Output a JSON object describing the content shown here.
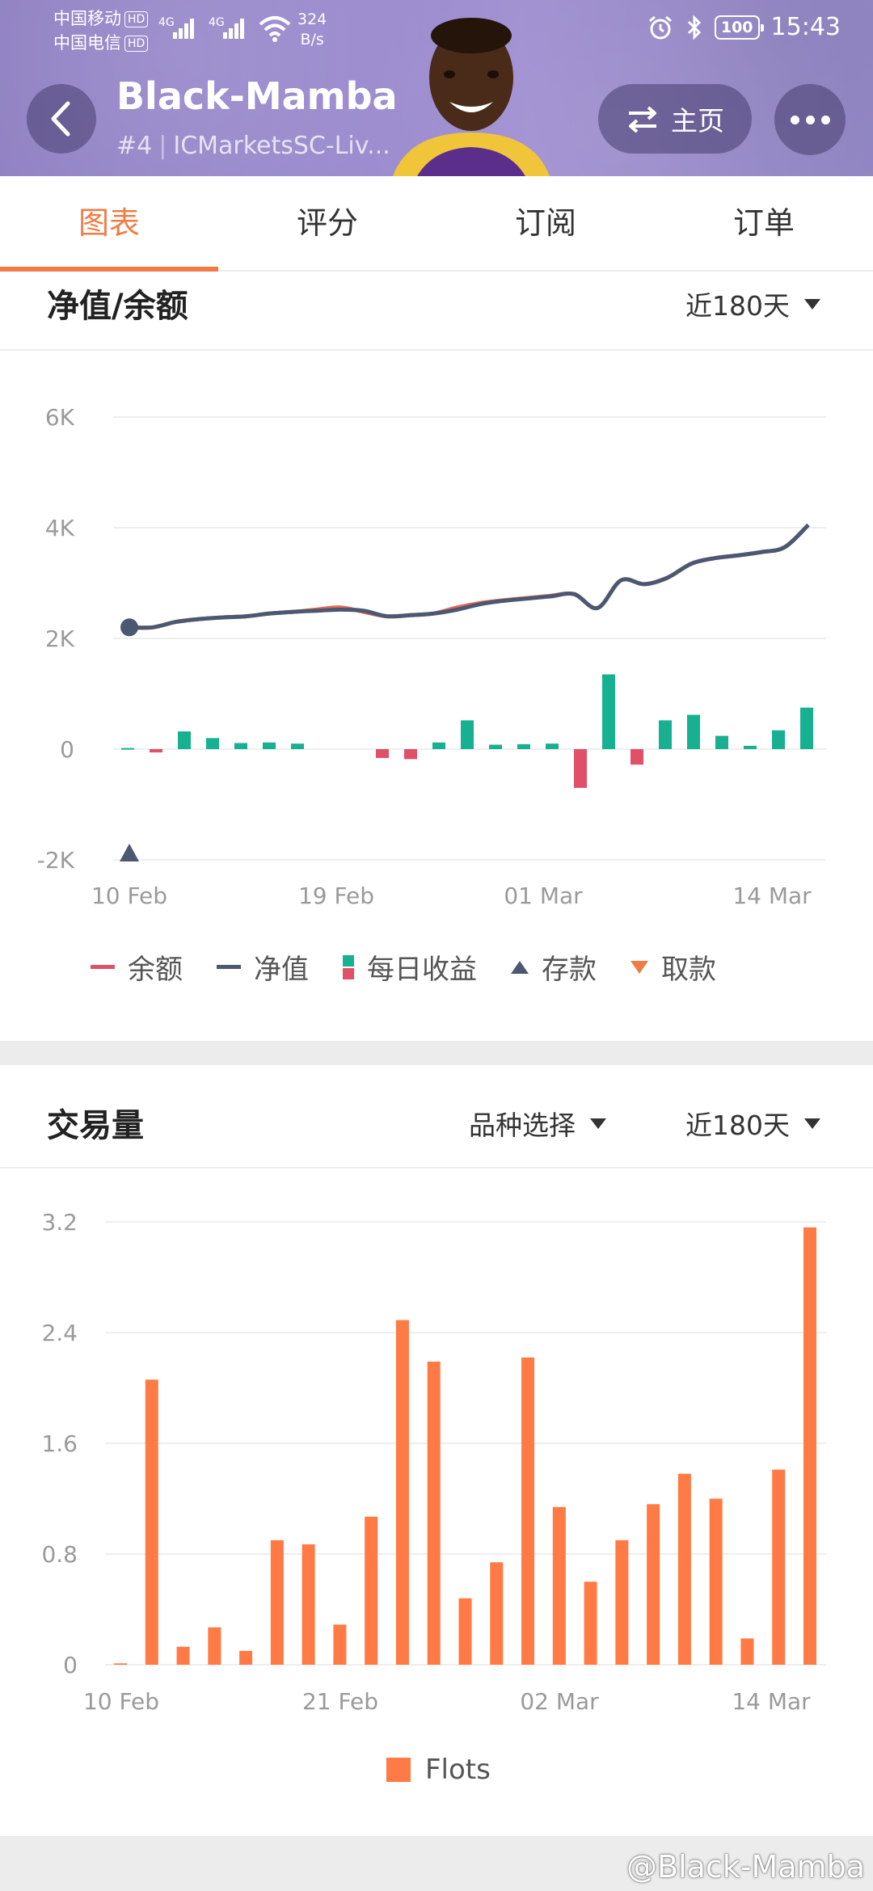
{
  "status_bar": {
    "carrier1": "中国移动",
    "carrier2": "中国电信",
    "hd": "HD",
    "net1": "4G",
    "net2": "4G",
    "speed_value": "324",
    "speed_unit": "B/s",
    "battery": "100",
    "time": "15:43"
  },
  "header": {
    "title": "Black-Mamba",
    "rank": "#4",
    "account": "ICMarketsSC-Liv...",
    "home_label": "主页"
  },
  "tabs": [
    {
      "label": "图表",
      "active": true
    },
    {
      "label": "评分",
      "active": false
    },
    {
      "label": "订阅",
      "active": false
    },
    {
      "label": "订单",
      "active": false
    }
  ],
  "equity_section": {
    "title": "净值/余额",
    "range_label": "近180天",
    "legend": {
      "balance": "余额",
      "equity": "净值",
      "daily": "每日收益",
      "deposit": "存款",
      "withdraw": "取款"
    }
  },
  "volume_section": {
    "title": "交易量",
    "symbol_label": "品种选择",
    "range_label": "近180天",
    "legend": "Flots"
  },
  "chart_data": [
    {
      "type": "line",
      "y_ticks": [
        "6K",
        "4K",
        "2K",
        "0",
        "-2K"
      ],
      "ylim": [
        -2000,
        6000
      ],
      "x_ticks": [
        "10 Feb",
        "19 Feb",
        "01 Mar",
        "14 Mar"
      ],
      "grid": true,
      "series": [
        {
          "name": "净值",
          "color": "#4a5871",
          "values": [
            2200,
            2200,
            2300,
            2350,
            2380,
            2400,
            2450,
            2480,
            2500,
            2520,
            2500,
            2400,
            2420,
            2450,
            2520,
            2620,
            2680,
            2720,
            2760,
            2800,
            2550,
            3050,
            2980,
            3100,
            3350,
            3450,
            3500,
            3560,
            3650,
            4050
          ]
        },
        {
          "name": "余额",
          "color": "#e05068",
          "values": [
            2200,
            2200,
            2300,
            2350,
            2380,
            2400,
            2450,
            2480,
            2520,
            2560,
            2480,
            2400,
            2420,
            2450,
            2560,
            2640,
            2690,
            2730,
            2770,
            2800,
            2550,
            3050,
            2980,
            3100,
            3350,
            3450,
            3500,
            3560,
            3650,
            4050
          ]
        },
        {
          "name": "每日收益",
          "type": "bar",
          "up_color": "#17b090",
          "down_color": "#e05068",
          "values": [
            20,
            -60,
            320,
            200,
            110,
            120,
            100,
            0,
            0,
            -160,
            -180,
            120,
            520,
            80,
            90,
            100,
            -700,
            1350,
            -280,
            520,
            620,
            240,
            60,
            340,
            750
          ]
        },
        {
          "name": "存款",
          "type": "marker",
          "points": [
            {
              "x": "10 Feb",
              "y": -2000
            }
          ]
        }
      ]
    },
    {
      "type": "bar",
      "y_ticks": [
        "3.2",
        "2.4",
        "1.6",
        "0.8",
        "0"
      ],
      "ylim": [
        0,
        3.2
      ],
      "x_ticks": [
        "10 Feb",
        "21 Feb",
        "02 Mar",
        "14 Mar"
      ],
      "grid": true,
      "series": [
        {
          "name": "Flots",
          "color": "#ff7a45",
          "values": [
            0.01,
            2.06,
            0.13,
            0.27,
            0.1,
            0.9,
            0.87,
            0.29,
            1.07,
            2.49,
            2.19,
            0.48,
            0.74,
            2.22,
            1.14,
            0.6,
            0.9,
            1.16,
            1.38,
            1.2,
            0.19,
            1.41,
            3.16
          ]
        }
      ]
    }
  ],
  "watermark": "@Black-Mamba"
}
